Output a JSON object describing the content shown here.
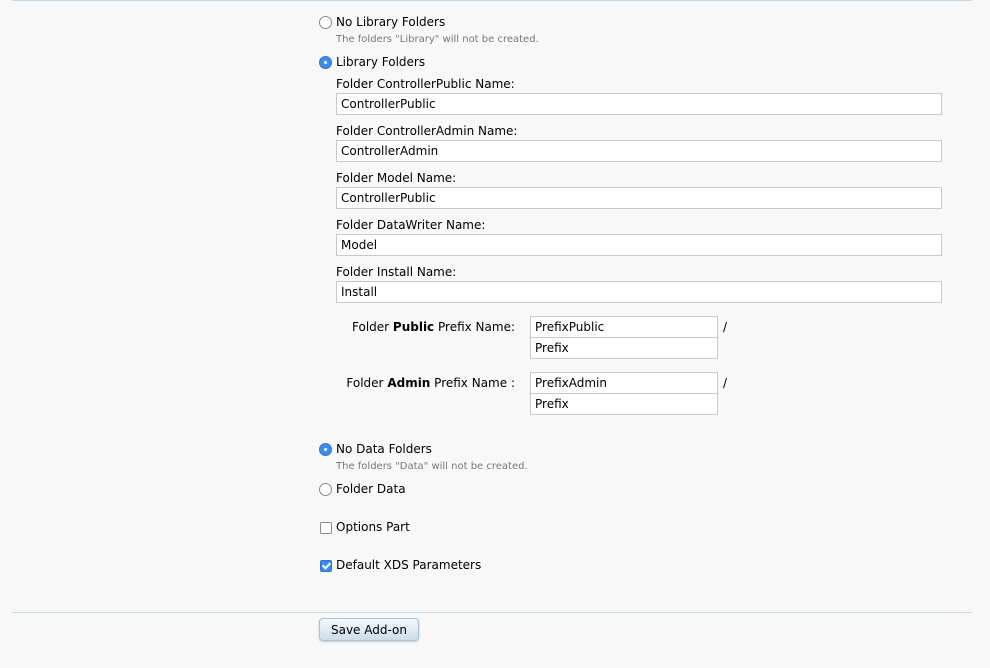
{
  "library": {
    "no_library_label": "No Library Folders",
    "no_library_hint": "The folders \"Library\" will not be created.",
    "library_label": "Library Folders",
    "fields": [
      {
        "label": "Folder ControllerPublic Name:",
        "value": "ControllerPublic"
      },
      {
        "label": "Folder ControllerAdmin Name:",
        "value": "ControllerAdmin"
      },
      {
        "label": "Folder Model Name:",
        "value": "ControllerPublic"
      },
      {
        "label": "Folder DataWriter Name:",
        "value": "Model"
      },
      {
        "label": "Folder Install Name:",
        "value": "Install"
      }
    ],
    "selected": "Library Folders"
  },
  "prefix": {
    "public": {
      "label_pre": "Folder ",
      "label_bold": "Public",
      "label_post": " Prefix Name:",
      "value_1": "PrefixPublic",
      "value_2": "Prefix",
      "separator": "/"
    },
    "admin": {
      "label_pre": "Folder ",
      "label_bold": "Admin",
      "label_post": " Prefix Name :",
      "value_1": "PrefixAdmin",
      "value_2": "Prefix",
      "separator": "/"
    }
  },
  "data": {
    "no_data_label": "No Data Folders",
    "no_data_hint": "The folders \"Data\" will not be created.",
    "folder_data_label": "Folder Data",
    "selected": "No Data Folders"
  },
  "options": {
    "options_part_label": "Options Part",
    "options_part_checked": false,
    "default_xds_label": "Default XDS Parameters",
    "default_xds_checked": true
  },
  "save_label": "Save Add-on"
}
